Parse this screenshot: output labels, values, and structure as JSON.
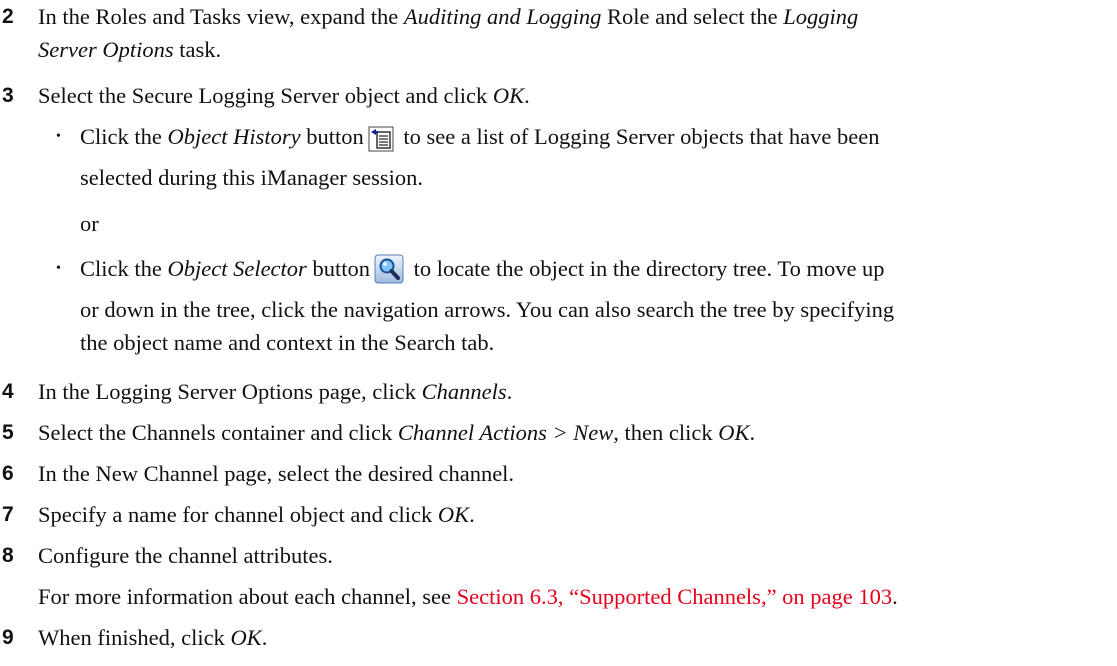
{
  "steps": [
    {
      "num": "2",
      "a": "In the Roles and Tasks view, expand the ",
      "b": "Auditing and Logging",
      "c": " Role and select the ",
      "d": "Logging",
      "e": "Server Options",
      "f": " task."
    },
    {
      "num": "3",
      "a": "Select the Secure Logging Server object and click ",
      "b": "OK",
      "c": "."
    },
    {
      "num": "4",
      "a": "In the Logging Server Options page, click ",
      "b": "Channels",
      "c": "."
    },
    {
      "num": "5",
      "a": "Select the Channels container and click ",
      "b": "Channel Actions > New",
      "c": ", then click ",
      "d": "OK",
      "e": "."
    },
    {
      "num": "6",
      "a": "In the New Channel page, select the desired channel."
    },
    {
      "num": "7",
      "a": "Specify a name for channel object and click ",
      "b": "OK",
      "c": "."
    },
    {
      "num": "8",
      "a": "Configure the channel attributes."
    },
    {
      "num": "9",
      "a": "When finished, click ",
      "b": "OK",
      "c": "."
    }
  ],
  "bullets": [
    {
      "a": "Click the ",
      "b": "Object History",
      "c": " button",
      "d": " to see a list of Logging Server objects that have been",
      "e": "selected during this iManager session."
    },
    {
      "a": "Click the ",
      "b": "Object Selector",
      "c": " button",
      "d": " to locate the object in the directory tree. To move up",
      "e": "or down in the tree, click the navigation arrows. You can also search the tree by specifying",
      "f": "the object name and context in the Search tab."
    }
  ],
  "or_text": "or",
  "bullet_glyph": "•",
  "note8": {
    "a": "For more information about each channel, see ",
    "link": "Section 6.3, “Supported Channels,” on page 103",
    "b": "."
  },
  "icons": {
    "history": "object-history-icon",
    "selector": "object-selector-icon"
  },
  "colors": {
    "link": "#e8001b"
  }
}
